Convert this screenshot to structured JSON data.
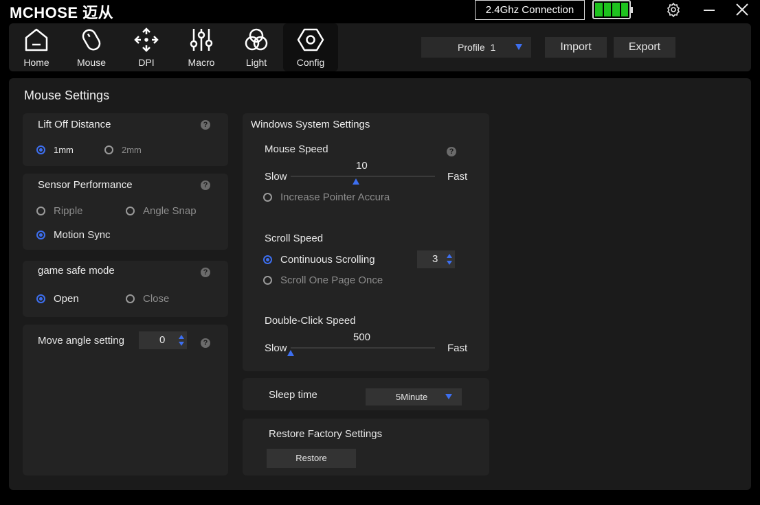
{
  "app": {
    "brand": "MCHOSE 迈从"
  },
  "titlebar": {
    "connection": "2.4Ghz Connection",
    "battery_level": 1.0,
    "battery_color": "#1ec21e"
  },
  "nav": {
    "items": [
      {
        "label": "Home",
        "icon": "home-icon"
      },
      {
        "label": "Mouse",
        "icon": "mouse-icon"
      },
      {
        "label": "DPI",
        "icon": "move-arrows-icon"
      },
      {
        "label": "Macro",
        "icon": "sliders-icon"
      },
      {
        "label": "Light",
        "icon": "light-circles-icon"
      },
      {
        "label": "Config",
        "icon": "hexagon-nut-icon"
      }
    ],
    "active": "Config",
    "profile": "Profile  1",
    "import_label": "Import",
    "export_label": "Export"
  },
  "main": {
    "title": "Mouse Settings"
  },
  "lift_off": {
    "title": "Lift Off Distance",
    "opt1": "1mm",
    "opt2": "2mm",
    "selected": "1mm"
  },
  "sensor": {
    "title": "Sensor Performance",
    "ripple": "Ripple",
    "angle_snap": "Angle Snap",
    "motion_sync": "Motion Sync",
    "motion_sync_on": true
  },
  "game_safe": {
    "title": "game safe mode",
    "open": "Open",
    "close": "Close",
    "selected": "Open"
  },
  "move_angle": {
    "title": "Move angle setting",
    "value": "0"
  },
  "windows": {
    "title": "Windows System Settings",
    "mouse_speed": {
      "label": "Mouse Speed",
      "value": "10",
      "slow": "Slow",
      "fast": "Fast",
      "level": 0.45
    },
    "pointer_accuracy": "Increase Pointer Accura",
    "scroll_speed": {
      "label": "Scroll Speed",
      "continuous": "Continuous Scrolling",
      "one_page": "Scroll One Page Once",
      "lines": "3"
    },
    "double_click": {
      "label": "Double-Click Speed",
      "value": "500",
      "slow": "Slow",
      "fast": "Fast",
      "level": 0.0
    }
  },
  "sleep": {
    "label": "Sleep time",
    "value": "5Minute"
  },
  "restore": {
    "title": "Restore Factory Settings",
    "button": "Restore"
  },
  "colors": {
    "accent": "#3d6ff0",
    "panel": "#1b1b1b",
    "card": "#232323"
  }
}
